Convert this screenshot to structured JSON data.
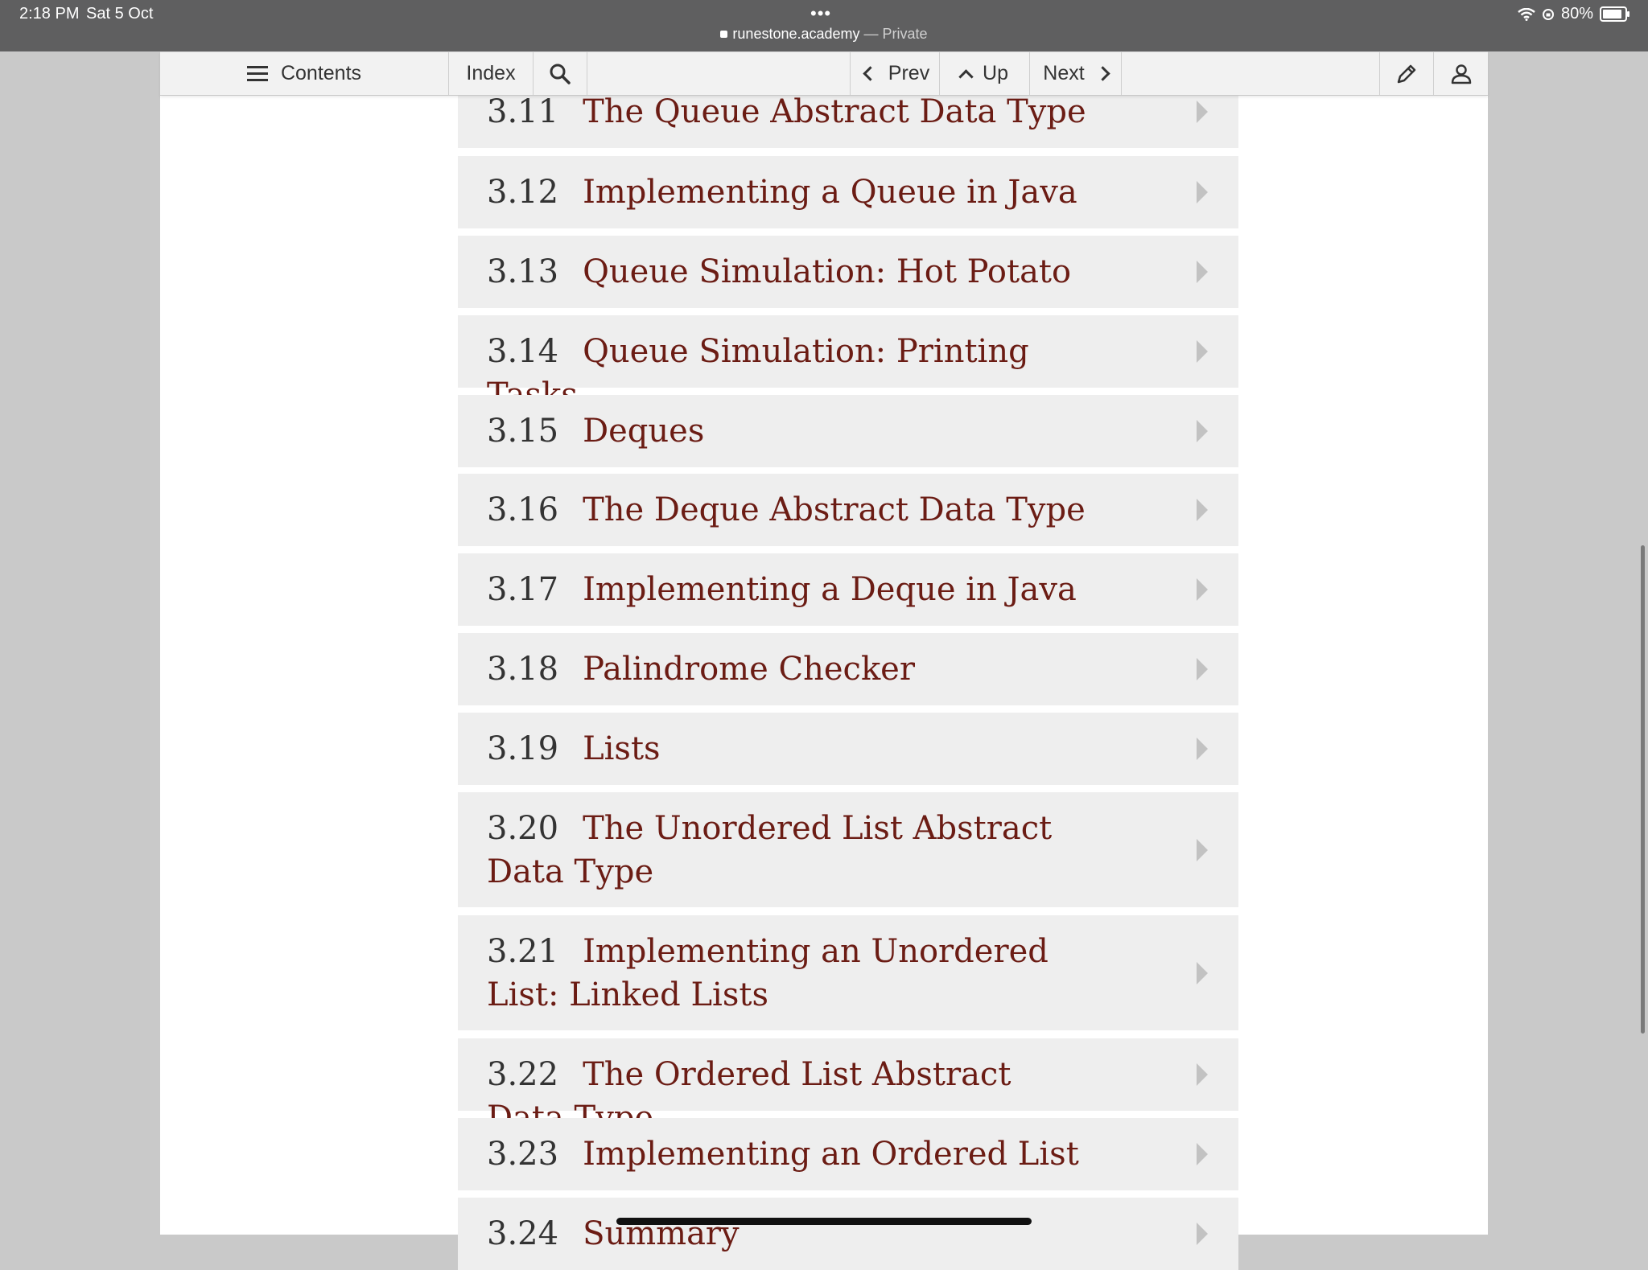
{
  "status_bar": {
    "time": "2:18 PM",
    "date": "Sat 5 Oct",
    "dots": "•••",
    "url": "runestone.academy",
    "url_suffix": " — Private",
    "battery": "80%"
  },
  "toolbar": {
    "contents_label": "Contents",
    "index_label": "Index",
    "prev_label": "Prev",
    "up_label": "Up",
    "next_label": "Next"
  },
  "toc": [
    {
      "num": "3.11",
      "title": "The Queue Abstract Data Type"
    },
    {
      "num": "3.12",
      "title": "Implementing a Queue in Java"
    },
    {
      "num": "3.13",
      "title": "Queue Simulation: Hot Potato"
    },
    {
      "num": "3.14",
      "title": "Queue Simulation: Printing Tasks"
    },
    {
      "num": "3.15",
      "title": "Deques"
    },
    {
      "num": "3.16",
      "title": "The Deque Abstract Data Type"
    },
    {
      "num": "3.17",
      "title": "Implementing a Deque in Java"
    },
    {
      "num": "3.18",
      "title": "Palindrome Checker"
    },
    {
      "num": "3.19",
      "title": "Lists"
    },
    {
      "num": "3.20",
      "title": "The Unordered List Abstract Data Type"
    },
    {
      "num": "3.21",
      "title": "Implementing an Unordered List: Linked Lists"
    },
    {
      "num": "3.22",
      "title": "The Ordered List Abstract Data Type"
    },
    {
      "num": "3.23",
      "title": "Implementing an Ordered List"
    },
    {
      "num": "3.24",
      "title": "Summary"
    }
  ]
}
